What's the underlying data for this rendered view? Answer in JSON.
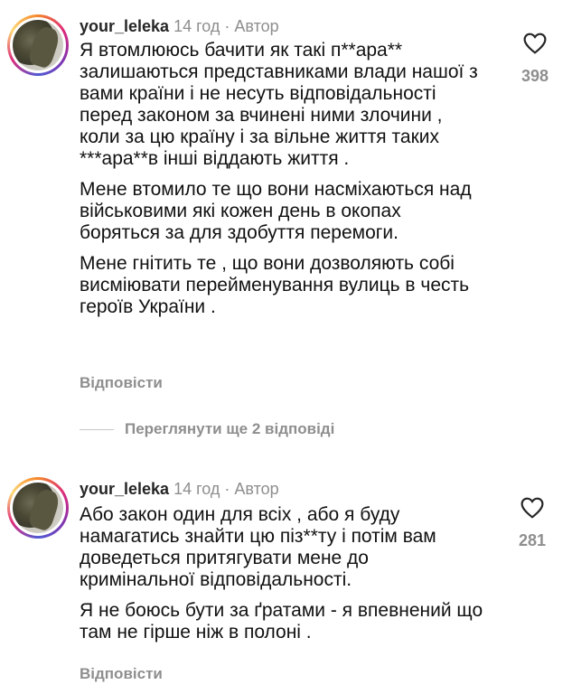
{
  "comments": [
    {
      "username": "your_leleka",
      "time": "14 год",
      "author_tag": "Автор",
      "paragraphs": [
        "Я втомлююсь бачити як такі п**ара** залишаються представниками влади нашої з вами країни і не несуть відповідальності перед законом за вчинені ними злочини , коли за цю країну і за вільне життя таких ***ара**в інші віддають життя .",
        "Мене втомило те що вони насміхаються над військовими які кожен день в окопах боряться за для здобуття перемоги.",
        "Мене гнітить те , що вони дозволяють собі висміювати перейменування вулиць в честь героїв України ."
      ],
      "reply_label": "Відповісти",
      "likes": "398",
      "like_icon": "heart-icon"
    },
    {
      "username": "your_leleka",
      "time": "14 год",
      "author_tag": "Автор",
      "paragraphs": [
        "Або закон один для всіх , або я буду намагатись знайти цю піз**ту і потім вам доведеться притягувати мене до кримінальної відповідальності.",
        "Я не боюсь бути за ґратами - я впевнений що там не гірше ніж в полоні ."
      ],
      "reply_label": "Відповісти",
      "likes": "281",
      "like_icon": "heart-icon"
    }
  ],
  "view_replies_label": "Переглянути ще 2 відповіді",
  "colors": {
    "secondary_text": "#8e8e8e",
    "username": "#262626",
    "divider": "#c7c7c7"
  }
}
